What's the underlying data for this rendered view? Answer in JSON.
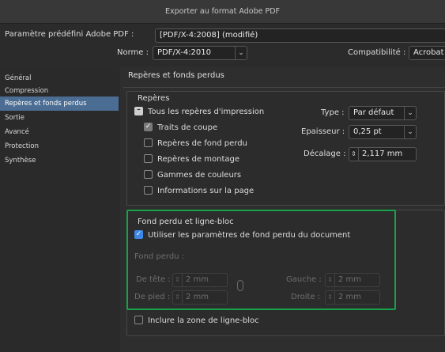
{
  "window": {
    "title": "Exporter au format Adobe PDF"
  },
  "preset": {
    "label": "Paramètre prédéfini Adobe PDF :",
    "value": "[PDF/X-4:2008] (modifié)"
  },
  "norme": {
    "label": "Norme :",
    "value": "PDF/X-4:2010"
  },
  "compat": {
    "label": "Compatibilité :",
    "value": "Acrobat"
  },
  "sidebar": {
    "items": [
      {
        "label": "Général"
      },
      {
        "label": "Compression"
      },
      {
        "label": "Repères et fonds perdus"
      },
      {
        "label": "Sortie"
      },
      {
        "label": "Avancé"
      },
      {
        "label": "Protection"
      },
      {
        "label": "Synthèse"
      }
    ],
    "active_index": 2
  },
  "main": {
    "section_title": "Repères et fonds perdus",
    "marks": {
      "title": "Repères",
      "all_marks": "Tous les repères d'impression",
      "crop_marks": "Traits de coupe",
      "bleed_marks": "Repères de fond perdu",
      "registration_marks": "Repères de montage",
      "color_bars": "Gammes de couleurs",
      "page_info": "Informations sur la page",
      "type_label": "Type :",
      "type_value": "Par défaut",
      "weight_label": "Epaisseur :",
      "weight_value": "0,25 pt",
      "offset_label": "Décalage :",
      "offset_value": "2,117 mm"
    },
    "bleed": {
      "title": "Fond perdu et ligne-bloc",
      "use_doc": "Utiliser les paramètres de fond perdu du document",
      "bleed_label": "Fond perdu :",
      "top_label": "De tête :",
      "top_value": "2 mm",
      "bottom_label": "De pied :",
      "bottom_value": "2 mm",
      "left_label": "Gauche :",
      "left_value": "2 mm",
      "right_label": "Droite :",
      "right_value": "2 mm",
      "slug": "Inclure la zone de ligne-bloc"
    }
  },
  "colors": {
    "accent": "#3d88e6",
    "selection": "#4b6d93",
    "highlight": "#17a24a"
  }
}
